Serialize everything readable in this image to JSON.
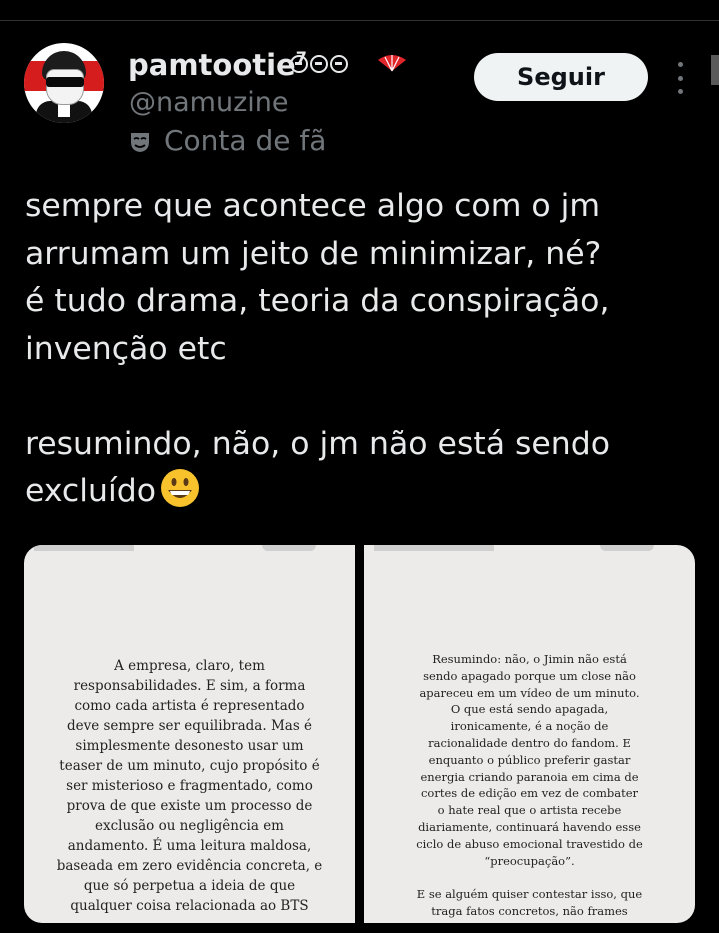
{
  "profile": {
    "username": "pamtootie",
    "superscript": "7",
    "handle": "@namuzine",
    "account_label": "Conta de fã",
    "follow_label": "Seguir"
  },
  "tweet": {
    "lines": [
      "sempre que acontece algo com o jm",
      "arrumam um jeito de minimizar, né?",
      "é tudo drama, teoria da conspiração,",
      "invenção etc",
      "resumindo, não, o jm não está sendo",
      "excluído"
    ]
  },
  "media": {
    "left_lines": [
      "A empresa, claro, tem",
      "responsabilidades. E sim, a forma",
      "como cada artista é representado",
      "deve sempre ser equilibrada. Mas é",
      "simplesmente desonesto usar um",
      "teaser de um minuto, cujo propósito é",
      "ser misterioso e fragmentado, como",
      "prova de que existe um processo de",
      "exclusão ou negligência em",
      "andamento. É uma leitura maldosa,",
      "baseada em zero evidência concreta, e",
      "que só perpetua a ideia de que",
      "qualquer coisa relacionada ao BTS"
    ],
    "right_lines": [
      "Resumindo: não, o Jimin não está",
      "sendo apagado porque um close não",
      "apareceu em um vídeo de um minuto.",
      "O que está sendo apagada,",
      "ironicamente, é a noção de",
      "racionalidade dentro do fandom. E",
      "enquanto o público preferir gastar",
      "energia criando paranoia em cima de",
      "cortes de edição em vez de combater",
      "o hate real que o artista recebe",
      "diariamente, continuará havendo esse",
      "ciclo de abuso emocional travestido de",
      "“preocupação”."
    ],
    "right_lines_2": [
      "E se alguém quiser contestar isso, que",
      "traga fatos concretos, não frames"
    ]
  },
  "icons": {
    "badges": [
      "circle-icon",
      "circle-icon",
      "circle-icon",
      "fan-icon"
    ],
    "account_icon": "mask-icon",
    "emoji": "grinning-face-emoji",
    "more": "more-vertical-icon"
  },
  "colors": {
    "background": "#000000",
    "text": "#e7e9ea",
    "muted": "#71767b",
    "button": "#eff3f4"
  }
}
